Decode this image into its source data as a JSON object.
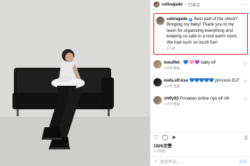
{
  "post": {
    "username": "celinajade",
    "follow_state": "已关注",
    "caption": "Best part of the shoot? Bringing my baby! Thank you to my team for organizing everything and keeping us safe in a nice warm room. We had such so much fun!",
    "caption_time": "1小时",
    "likes": "1926次赞",
    "post_time": "1小时前",
    "comment_placeholder": "添加评论……",
    "post_button": "发布"
  },
  "comments": [
    {
      "user": "mouffet_",
      "text": "baby elf",
      "emoji": "💙 🩷 💜",
      "meta": "1小时   回复"
    },
    {
      "user": "wafa.elf.ksa",
      "text": "princess ELF",
      "emoji": "💙💙💙💙💙",
      "meta": "1小时   回复"
    },
    {
      "user": "shfly93",
      "text": "Ponakan online nya elf nih",
      "emoji": "",
      "meta": "1小时   回复"
    }
  ],
  "colors": {
    "highlight": "#e0201b",
    "verified": "#3897f0",
    "sofa": "#151515",
    "wall": "#d9d9d7"
  }
}
